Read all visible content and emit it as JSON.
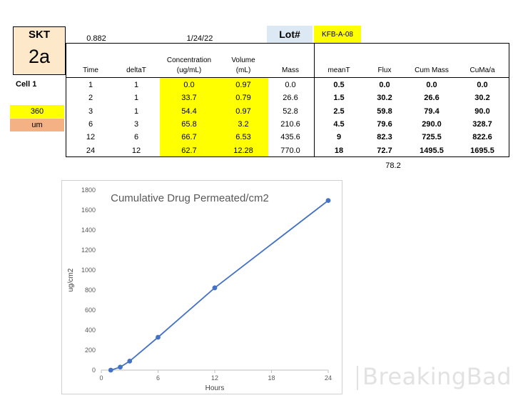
{
  "header": {
    "skt_label": "SKT",
    "skt_id": "2a",
    "factor": "0.882",
    "date": "1/24/22",
    "lot_label": "Lot#",
    "lot_value": "KFB-A-08"
  },
  "left_panel": {
    "cell_label": "Cell 1",
    "thickness_value": "360",
    "thickness_unit": "um"
  },
  "table": {
    "columns": [
      "Time",
      "deltaT",
      "Concentration (ug/mL)",
      "Volume (mL)",
      "Mass",
      "meanT",
      "Flux",
      "Cum Mass",
      "CuMa/a"
    ],
    "col_conc_1": "Concentration",
    "col_conc_2": "(ug/mL)",
    "col_vol_1": "Volume",
    "col_vol_2": "(mL)",
    "rows": [
      {
        "time": "1",
        "deltaT": "1",
        "conc": "0.0",
        "vol": "0.97",
        "mass": "0.0",
        "meanT": "0.5",
        "flux": "0.0",
        "cum_mass": "0.0",
        "cuma": "0.0"
      },
      {
        "time": "2",
        "deltaT": "1",
        "conc": "33.7",
        "vol": "0.79",
        "mass": "26.6",
        "meanT": "1.5",
        "flux": "30.2",
        "cum_mass": "26.6",
        "cuma": "30.2"
      },
      {
        "time": "3",
        "deltaT": "1",
        "conc": "54.4",
        "vol": "0.97",
        "mass": "52.8",
        "meanT": "2.5",
        "flux": "59.8",
        "cum_mass": "79.4",
        "cuma": "90.0"
      },
      {
        "time": "6",
        "deltaT": "3",
        "conc": "65.8",
        "vol": "3.2",
        "mass": "210.6",
        "meanT": "4.5",
        "flux": "79.6",
        "cum_mass": "290.0",
        "cuma": "328.7"
      },
      {
        "time": "12",
        "deltaT": "6",
        "conc": "66.7",
        "vol": "6.53",
        "mass": "435.6",
        "meanT": "9",
        "flux": "82.3",
        "cum_mass": "725.5",
        "cuma": "822.6"
      },
      {
        "time": "24",
        "deltaT": "12",
        "conc": "62.7",
        "vol": "12.28",
        "mass": "770.0",
        "meanT": "18",
        "flux": "72.7",
        "cum_mass": "1495.5",
        "cuma": "1695.5"
      }
    ],
    "flux_summary": "78.2"
  },
  "chart_data": {
    "type": "line",
    "title": "Cumulative Drug Permeated/cm2",
    "xlabel": "Hours",
    "ylabel": "ug/cm2",
    "x": [
      1,
      2,
      3,
      6,
      12,
      24
    ],
    "y": [
      0.0,
      30.2,
      90.0,
      328.7,
      822.6,
      1695.5
    ],
    "xlim": [
      0,
      24
    ],
    "ylim": [
      0,
      1800
    ],
    "xticks": [
      "0",
      "6",
      "12",
      "18",
      "24"
    ],
    "yticks": [
      "0",
      "200",
      "400",
      "600",
      "800",
      "1000",
      "1200",
      "1400",
      "1600",
      "1800"
    ],
    "grid": false,
    "line_color": "#4472c4"
  },
  "watermark": "BreakingBad"
}
